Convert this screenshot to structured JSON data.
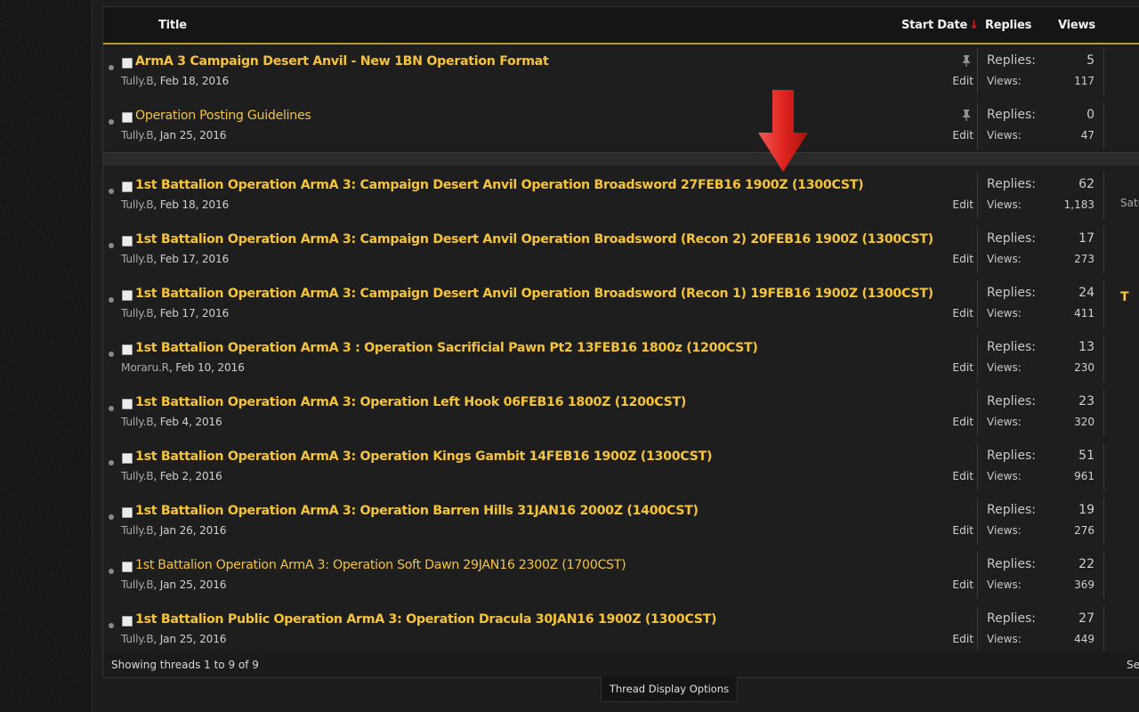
{
  "header": {
    "title": "Title",
    "start_date": "Start Date",
    "sort_arrow": "↓",
    "replies": "Replies",
    "views": "Views"
  },
  "labels": {
    "replies": "Replies:",
    "views": "Views:",
    "edit": "Edit"
  },
  "sticky_threads": [
    {
      "title": "ArmA 3 Campaign Desert Anvil - New 1BN Operation Format",
      "bold": true,
      "author": "Tully.B",
      "date": "Feb 18, 2016",
      "replies": "5",
      "views": "117"
    },
    {
      "title": "Operation Posting Guidelines",
      "bold": false,
      "author": "Tully.B",
      "date": "Jan 25, 2016",
      "replies": "0",
      "views": "47"
    }
  ],
  "threads": [
    {
      "title": "1st Battalion Operation ArmA 3: Campaign Desert Anvil Operation Broadsword 27FEB16 1900Z (1300CST)",
      "bold": true,
      "author": "Tully.B",
      "date": "Feb 18, 2016",
      "replies": "62",
      "views": "1,183",
      "last_fragment": "Satu",
      "last_gold": false
    },
    {
      "title": "1st Battalion Operation ArmA 3: Campaign Desert Anvil Operation Broadsword (Recon 2) 20FEB16 1900Z (1300CST)",
      "bold": true,
      "author": "Tully.B",
      "date": "Feb 17, 2016",
      "replies": "17",
      "views": "273",
      "last_fragment": "",
      "last_gold": false
    },
    {
      "title": "1st Battalion Operation ArmA 3: Campaign Desert Anvil Operation Broadsword (Recon 1) 19FEB16 1900Z (1300CST)",
      "bold": true,
      "author": "Tully.B",
      "date": "Feb 17, 2016",
      "replies": "24",
      "views": "411",
      "last_fragment": "T",
      "last_gold": true
    },
    {
      "title": "1st Battalion Operation ArmA 3 : Operation Sacrificial Pawn Pt2 13FEB16 1800z (1200CST)",
      "bold": true,
      "author": "Moraru.R",
      "date": "Feb 10, 2016",
      "replies": "13",
      "views": "230",
      "last_fragment": "",
      "last_gold": false
    },
    {
      "title": "1st Battalion Operation ArmA 3: Operation Left Hook 06FEB16 1800Z (1200CST)",
      "bold": true,
      "author": "Tully.B",
      "date": "Feb 4, 2016",
      "replies": "23",
      "views": "320",
      "last_fragment": "",
      "last_gold": false
    },
    {
      "title": "1st Battalion Operation ArmA 3: Operation Kings Gambit 14FEB16 1900Z (1300CST)",
      "bold": true,
      "author": "Tully.B",
      "date": "Feb 2, 2016",
      "replies": "51",
      "views": "961",
      "last_fragment": "",
      "last_gold": false
    },
    {
      "title": "1st Battalion Operation ArmA 3: Operation Barren Hills 31JAN16 2000Z (1400CST)",
      "bold": true,
      "author": "Tully.B",
      "date": "Jan 26, 2016",
      "replies": "19",
      "views": "276",
      "last_fragment": "",
      "last_gold": false
    },
    {
      "title": "1st Battalion Operation ArmA 3: Operation Soft Dawn 29JAN16 2300Z (1700CST)",
      "bold": false,
      "author": "Tully.B",
      "date": "Jan 25, 2016",
      "replies": "22",
      "views": "369",
      "last_fragment": "",
      "last_gold": false
    },
    {
      "title": "1st Battalion Public Operation ArmA 3: Operation Dracula 30JAN16 1900Z (1300CST)",
      "bold": true,
      "author": "Tully.B",
      "date": "Jan 25, 2016",
      "replies": "27",
      "views": "449",
      "last_fragment": "",
      "last_gold": false
    }
  ],
  "footer": {
    "showing": "Showing threads 1 to 9 of 9",
    "right_fragment": "Se"
  },
  "display_options": "Thread Display Options",
  "colors": {
    "link": "#f4c33a",
    "header_rule": "#b89a2e",
    "sort_arrow": "#e21c1c",
    "annotation_arrow": "#d9201c"
  },
  "icons": {
    "sticky": "pin-icon",
    "annotation": "red-down-arrow-icon"
  }
}
